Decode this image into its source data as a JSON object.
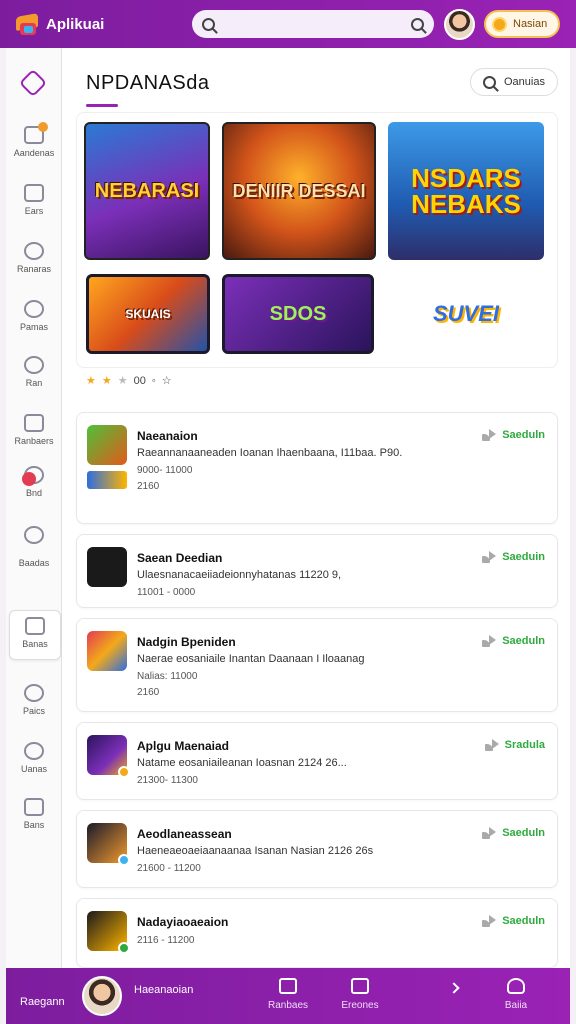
{
  "app": {
    "name": "Aplikuai"
  },
  "search": {
    "placeholder": "",
    "value": ""
  },
  "header": {
    "coin_label": "Nasian"
  },
  "sidebar": {
    "items": [
      {
        "label": "Aandenas",
        "icon": "gift-icon"
      },
      {
        "label": "Ears",
        "icon": "phone-icon"
      },
      {
        "label": "Ranaras",
        "icon": "search-icon"
      },
      {
        "label": "Pamas",
        "icon": "clock-icon"
      },
      {
        "label": "Ran",
        "icon": "settings-icon"
      },
      {
        "label": "Ranbaers",
        "icon": "list-icon"
      },
      {
        "label": "Bnd",
        "icon": "chrome-icon"
      },
      {
        "label": "Baadas",
        "icon": "cloud-icon"
      },
      {
        "label": "Banas",
        "icon": "share-icon"
      },
      {
        "label": "Paics",
        "icon": "search-icon"
      },
      {
        "label": "Uanas",
        "icon": "search-icon"
      },
      {
        "label": "Bans",
        "icon": "folder-icon"
      }
    ]
  },
  "main": {
    "title": "NPDANASda",
    "filter_label": "Oanuias",
    "featured": [
      {
        "title": "NEBARASI"
      },
      {
        "title": "DENIIR DESSAI"
      },
      {
        "title": "NSDARS NEBAKS"
      },
      {
        "title": "SKUAIS"
      },
      {
        "title": "SDOS"
      },
      {
        "title": "SUVEI"
      }
    ],
    "rating_text": "00"
  },
  "list": [
    {
      "title": "Naeanaion",
      "desc": "Raeannanaaneaden Ioanan Ihaenbaana, I11baa. P90.",
      "meta1": "9000- 11000",
      "meta2": "2160",
      "action": "Saeduln"
    },
    {
      "title": "Saean Deedian",
      "desc": "Ulaesnanacaeiiadeionnyhatanas 11220 9,",
      "meta1": "11001 - 0000",
      "meta2": "",
      "action": "Saeduin"
    },
    {
      "title": "Nadgin Bpeniden",
      "desc": "Naerae eosaniaile Inantan Daanaan I Iloaanag",
      "meta1": "Nalias: 11000",
      "meta2": "2160",
      "action": "Saeduln"
    },
    {
      "title": "Aplgu Maenaiad",
      "desc": "Natame eosaniaileanan Ioasnan 2124 26...",
      "meta1": "21300- 11300",
      "meta2": "",
      "action": "Sradula"
    },
    {
      "title": "Aeodlaneassean",
      "desc": "Haeneaeoaeiaanaanaa Isanan Nasian 2126 26s",
      "meta1": "21600 - 11200",
      "meta2": "",
      "action": "Saeduln"
    },
    {
      "title": "Nadayiaoaeaion",
      "desc": "",
      "meta1": "2116 - 11200",
      "meta2": "",
      "action": "Saeduln"
    }
  ],
  "bottom": {
    "user_label": "Raegann",
    "name": "Haeanaoian",
    "tabs": [
      {
        "label": "Ranbaes"
      },
      {
        "label": "Ereones"
      },
      {
        "label": "Baiia"
      }
    ]
  },
  "colors": {
    "accent": "#9a22b5",
    "action_green": "#2eaa3e",
    "coin": "#f2a91a"
  }
}
